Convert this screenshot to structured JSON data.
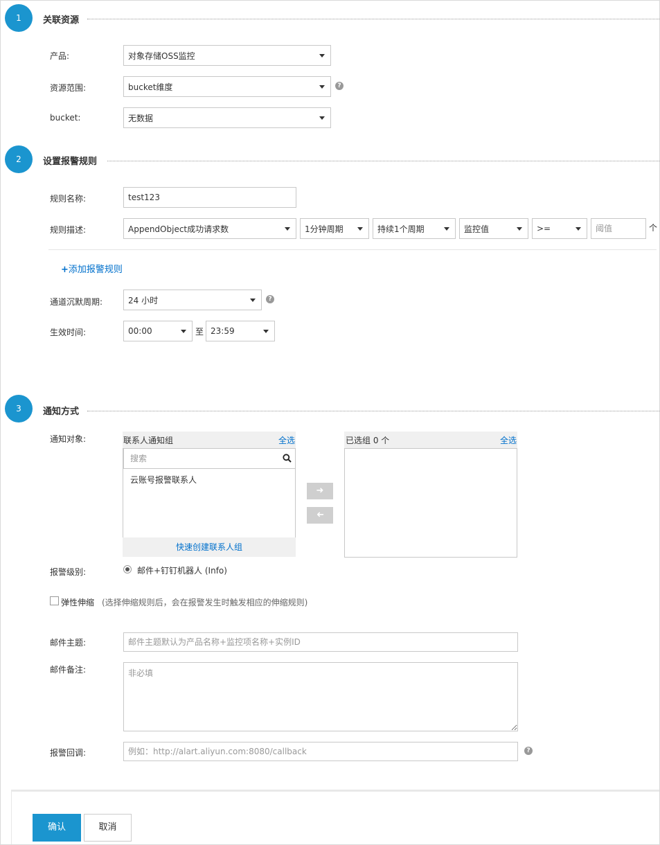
{
  "steps": [
    {
      "num": "1",
      "title": "关联资源"
    },
    {
      "num": "2",
      "title": "设置报警规则"
    },
    {
      "num": "3",
      "title": "通知方式"
    }
  ],
  "resource": {
    "product_label": "产品:",
    "product_value": "对象存储OSS监控",
    "scope_label": "资源范围:",
    "scope_value": "bucket维度",
    "bucket_label": "bucket:",
    "bucket_value": "无数据"
  },
  "rule": {
    "name_label": "规则名称:",
    "name_value": "test123",
    "desc_label": "规则描述:",
    "metric_value": "AppendObject成功请求数",
    "period_value": "1分钟周期",
    "duration_value": "持续1个周期",
    "stat_value": "监控值",
    "operator_value": ">=",
    "threshold_placeholder": "阈值",
    "unit_text": "个",
    "add_rule_link": "添加报警规则",
    "silence_label": "通道沉默周期:",
    "silence_value": "24 小时",
    "effective_label": "生效时间:",
    "start_time": "00:00",
    "to_text": "至",
    "end_time": "23:59"
  },
  "notify": {
    "target_label": "通知对象:",
    "group_header": "联系人通知组",
    "select_all": "全选",
    "search_placeholder": "搜索",
    "contacts": [
      "云账号报警联系人"
    ],
    "quick_create": "快速创建联系人组",
    "selected_header": "已选组 0 个",
    "selected_all": "全选",
    "level_label": "报警级别:",
    "level_option": "邮件+钉钉机器人 (Info)",
    "elastic_label": "弹性伸缩",
    "elastic_hint": "(选择伸缩规则后，会在报警发生时触发相应的伸缩规则)",
    "mail_subject_label": "邮件主题:",
    "mail_subject_placeholder": "邮件主题默认为产品名称+监控项名称+实例ID",
    "mail_note_label": "邮件备注:",
    "mail_note_placeholder": "非必填",
    "callback_label": "报警回调:",
    "callback_placeholder": "例如：http://alart.aliyun.com:8080/callback"
  },
  "footer": {
    "confirm": "确认",
    "cancel": "取消"
  },
  "colors": {
    "accent": "#1b95cf",
    "link": "#0070cc"
  }
}
